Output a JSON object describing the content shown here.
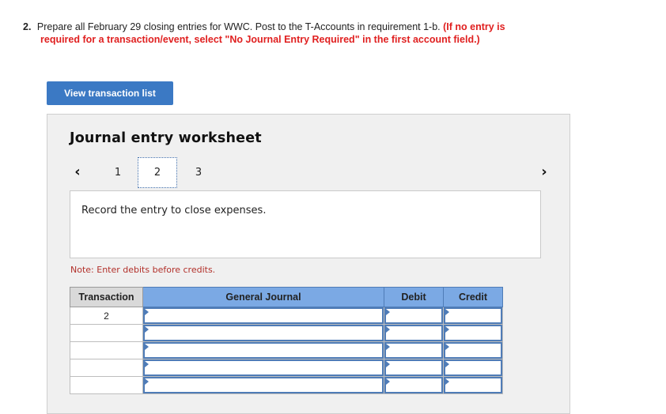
{
  "question": {
    "number": "2.",
    "text": "Prepare all February 29 closing entries for WWC. Post to the T-Accounts in requirement 1-b.",
    "instruction": "(If no entry is required for a transaction/event, select \"No Journal Entry Required\" in the first account field.)"
  },
  "view_button": "View transaction list",
  "worksheet": {
    "title": "Journal entry worksheet",
    "nav": {
      "prev_icon": "chevron-left-icon",
      "next_icon": "chevron-right-icon",
      "pages": [
        "1",
        "2",
        "3"
      ],
      "current": "2"
    },
    "description": "Record the entry to close expenses.",
    "note": "Note: Enter debits before credits.",
    "table": {
      "headers": {
        "transaction": "Transaction",
        "general_journal": "General Journal",
        "debit": "Debit",
        "credit": "Credit"
      },
      "rows": [
        {
          "transaction": "2",
          "account": "",
          "debit": "",
          "credit": ""
        },
        {
          "transaction": "",
          "account": "",
          "debit": "",
          "credit": ""
        },
        {
          "transaction": "",
          "account": "",
          "debit": "",
          "credit": ""
        },
        {
          "transaction": "",
          "account": "",
          "debit": "",
          "credit": ""
        },
        {
          "transaction": "",
          "account": "",
          "debit": "",
          "credit": ""
        }
      ]
    }
  },
  "colors": {
    "button": "#3b79c4",
    "header": "#7ba9e4",
    "instruction": "#e02020",
    "note": "#b2302a"
  }
}
